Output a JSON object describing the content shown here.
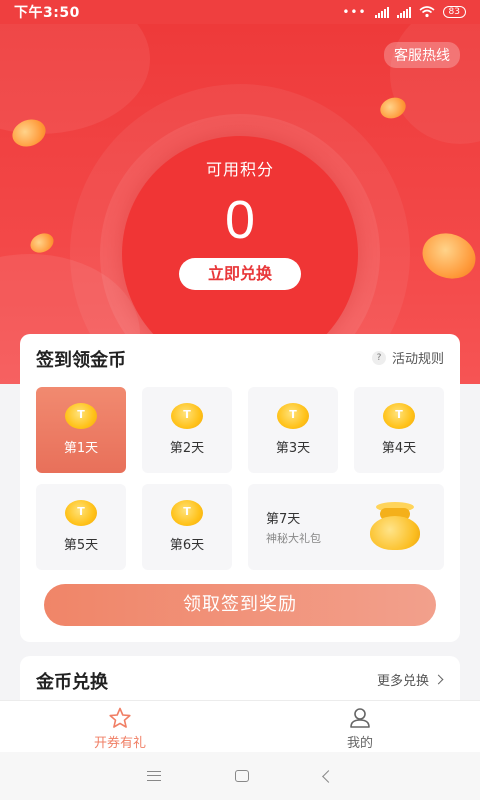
{
  "status_bar": {
    "time": "下午3:50",
    "battery": "83",
    "network": "HD"
  },
  "hero": {
    "service_label": "客服热线",
    "points_label": "可用积分",
    "points_value": "0",
    "redeem_label": "立即兑换"
  },
  "checkin": {
    "title": "签到领金币",
    "rules_label": "活动规则",
    "days": [
      {
        "label": "第1天",
        "active": true
      },
      {
        "label": "第2天",
        "active": false
      },
      {
        "label": "第3天",
        "active": false
      },
      {
        "label": "第4天",
        "active": false
      },
      {
        "label": "第5天",
        "active": false
      },
      {
        "label": "第6天",
        "active": false
      }
    ],
    "day7": {
      "label": "第7天",
      "subtitle": "神秘大礼包"
    },
    "claim_label": "领取签到奖励"
  },
  "exchange": {
    "title": "金币兑换",
    "more_label": "更多兑换"
  },
  "tabbar": {
    "tabs": [
      {
        "label": "开券有礼",
        "icon": "star-icon",
        "active": true
      },
      {
        "label": "我的",
        "icon": "user-icon",
        "active": false
      }
    ]
  },
  "colors": {
    "brand_red": "#ef3f3f",
    "accent_orange": "#f07f65",
    "coin_gold": "#ffc21a"
  }
}
